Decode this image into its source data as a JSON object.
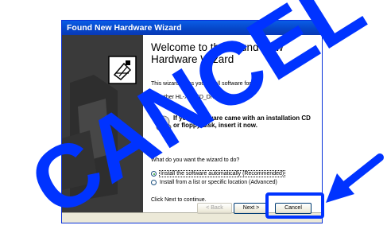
{
  "window": {
    "title": "Found New Hardware Wizard"
  },
  "content": {
    "heading": "Welcome to the Found New Hardware Wizard",
    "intro_visible": "This wizard helps you install software for:",
    "device_name": "Brother HL-XXXXD_DN series",
    "cd_prompt": "If your hardware came with an installation CD or floppy disk, insert it now.",
    "question": "What do you want the wizard to do?",
    "options": [
      {
        "label": "Install the software automatically (Recommended)",
        "checked": true
      },
      {
        "label": "Install from a list or specific location (Advanced)",
        "checked": false
      }
    ],
    "continue_hint": "Click Next to continue."
  },
  "buttons": {
    "back": "< Back",
    "next": "Next >",
    "cancel": "Cancel"
  },
  "overlay": {
    "word": "CANCEL",
    "color": "#0033ff"
  },
  "icons": [
    "wizard-hardware-icon",
    "cd-icon",
    "arrow-icon"
  ]
}
